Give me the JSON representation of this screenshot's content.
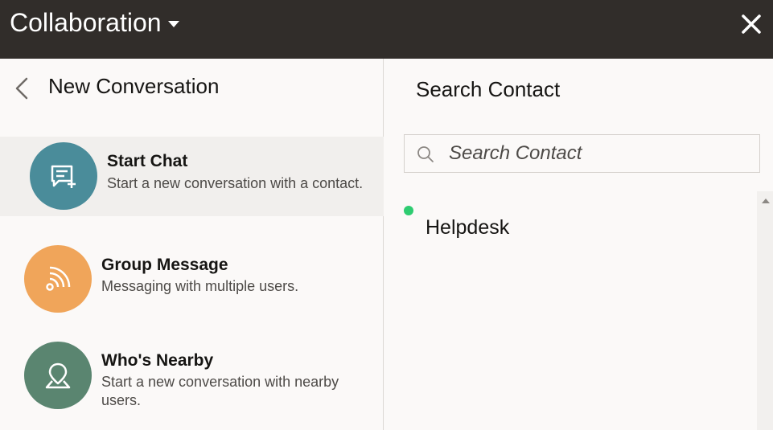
{
  "header": {
    "title": "Collaboration",
    "title_icon": "caret-down-icon",
    "close_icon": "close-icon"
  },
  "left_panel": {
    "title": "New Conversation",
    "back_icon": "chevron-left-icon",
    "options": [
      {
        "title": "Start Chat",
        "description": "Start a new conversation with a contact.",
        "icon": "chat-add-icon",
        "color": "#4a8c9a",
        "selected": true
      },
      {
        "title": "Group Message",
        "description": "Messaging with multiple users.",
        "icon": "broadcast-icon",
        "color": "#f0a55a",
        "selected": false
      },
      {
        "title": "Who's Nearby",
        "description_line1": "Start a new conversation with nearby",
        "description_line2": "users.",
        "icon": "location-pin-icon",
        "color": "#5a8570",
        "selected": false
      }
    ]
  },
  "right_panel": {
    "title": "Search Contact",
    "search": {
      "placeholder": "Search Contact",
      "value": "",
      "icon": "search-icon"
    },
    "contacts": [
      {
        "name": "Helpdesk",
        "status": "online",
        "status_color": "#2ecc71"
      }
    ]
  },
  "colors": {
    "header_bg": "#312d2a",
    "panel_bg": "#fbf9f8",
    "selected_bg": "#f1efed"
  }
}
